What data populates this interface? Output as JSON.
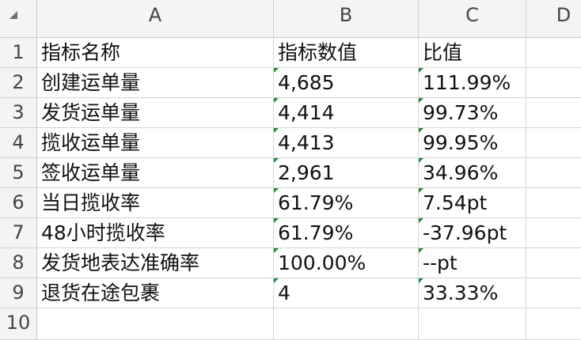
{
  "columns": [
    "A",
    "B",
    "C",
    "D"
  ],
  "rows": [
    "1",
    "2",
    "3",
    "4",
    "5",
    "6",
    "7",
    "8",
    "9",
    "10"
  ],
  "cells": [
    [
      "指标名称",
      "指标数值",
      "比值"
    ],
    [
      "创建运单量",
      "4,685",
      "111.99%"
    ],
    [
      "发货运单量",
      "4,414",
      "99.73%"
    ],
    [
      "揽收运单量",
      "4,413",
      "99.95%"
    ],
    [
      "签收运单量",
      "2,961",
      "34.96%"
    ],
    [
      "当日揽收率",
      "61.79%",
      "7.54pt"
    ],
    [
      "48小时揽收率",
      "61.79%",
      "-37.96pt"
    ],
    [
      "发货地表达准确率",
      "100.00%",
      "--pt"
    ],
    [
      "退货在途包裹",
      "4",
      "33.33%"
    ]
  ],
  "colors": {
    "header_bg": "#f4f4f4",
    "gridline": "#d4d4d4",
    "error_flag": "#1f8a3a"
  }
}
